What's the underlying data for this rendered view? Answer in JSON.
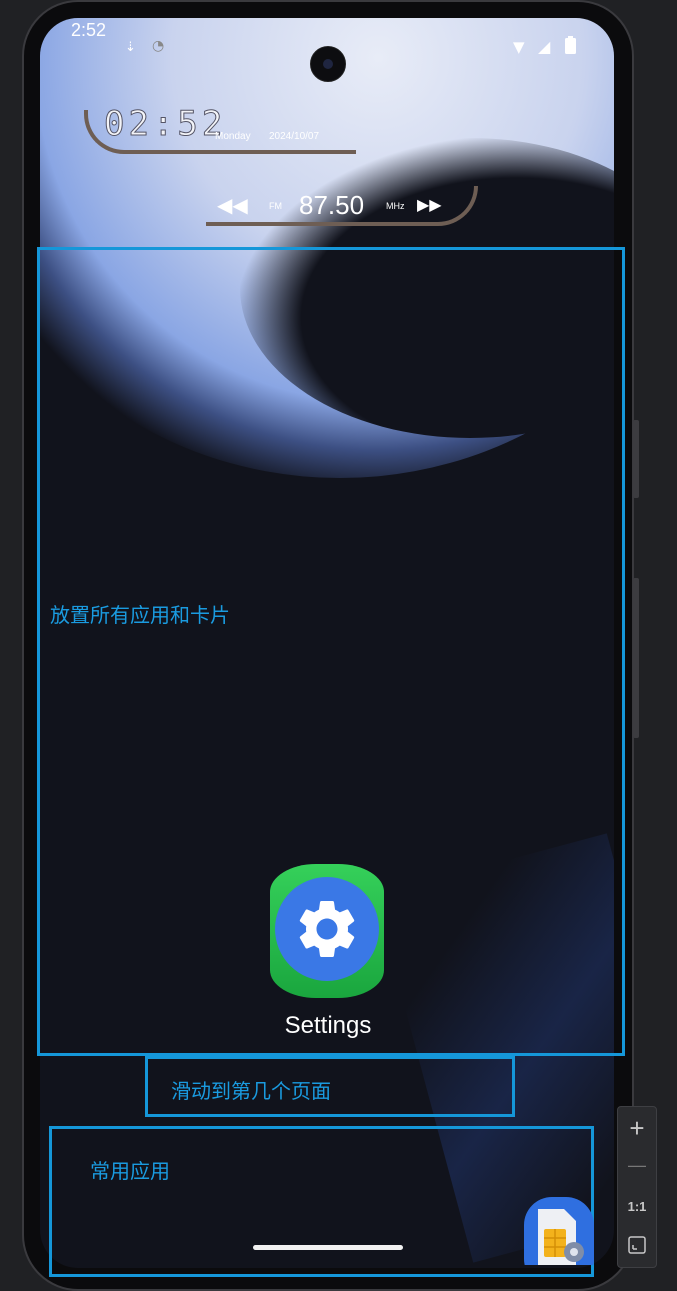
{
  "status_bar": {
    "time": "2:52",
    "icons": [
      "download-status-icon",
      "wifi-unknown-icon",
      "wifi-icon",
      "cellular-signal-icon",
      "battery-icon"
    ]
  },
  "clock_widget": {
    "time": "02:52",
    "day": "Monday",
    "date": "2024/10/07"
  },
  "radio_widget": {
    "band": "FM",
    "frequency": "87.50",
    "unit": "MHz",
    "prev_icon": "rewind-icon",
    "next_icon": "fast-forward-icon"
  },
  "annotations": {
    "apps_area_label": "放置所有应用和卡片",
    "page_indicator_label": "滑动到第几个页面",
    "dock_label": "常用应用",
    "color": "#1597d9"
  },
  "apps": [
    {
      "label": "Settings",
      "icon": "settings-gear-icon"
    }
  ],
  "dock_apps": [
    {
      "icon": "sim-toolkit-icon"
    }
  ],
  "zoom_toolbar": {
    "zoom_in": "+",
    "zoom_out": "—",
    "actual_size": "1:1",
    "fit_icon": "fit-to-screen-icon"
  }
}
